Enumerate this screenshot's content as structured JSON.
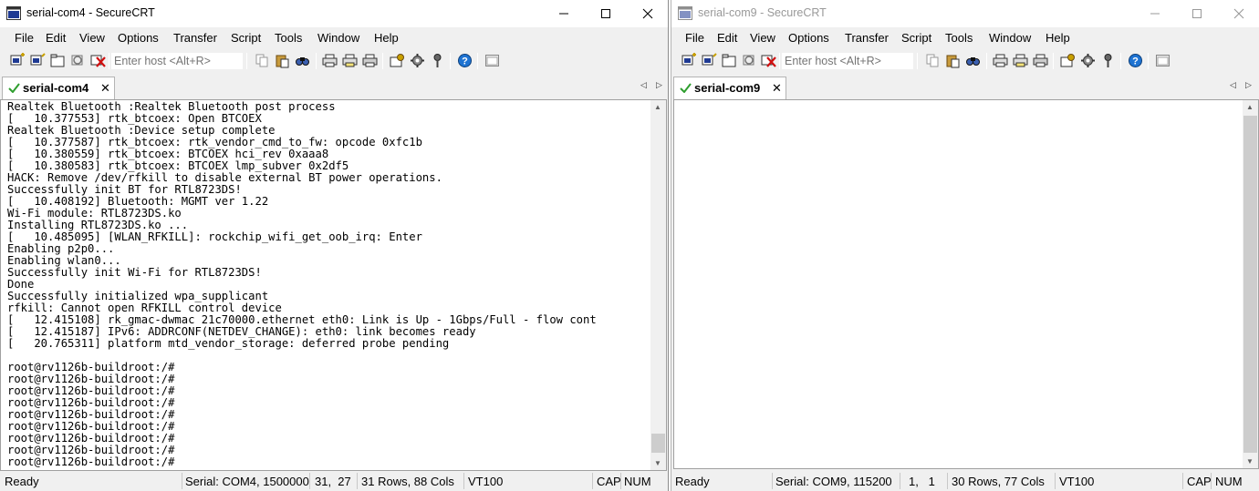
{
  "menu_labels": [
    "File",
    "Edit",
    "View",
    "Options",
    "Transfer",
    "Script",
    "Tools",
    "Window",
    "Help"
  ],
  "host_placeholder": "Enter host <Alt+R>",
  "left": {
    "title": "serial-com4 - SecureCRT",
    "tab_label": "serial-com4",
    "terminal_lines": [
      "Realtek Bluetooth :Realtek Bluetooth post process",
      "[   10.377553] rtk_btcoex: Open BTCOEX",
      "Realtek Bluetooth :Device setup complete",
      "[   10.377587] rtk_btcoex: rtk_vendor_cmd_to_fw: opcode 0xfc1b",
      "[   10.380559] rtk_btcoex: BTCOEX hci_rev 0xaaa8",
      "[   10.380583] rtk_btcoex: BTCOEX lmp_subver 0x2df5",
      "HACK: Remove /dev/rfkill to disable external BT power operations.",
      "Successfully init BT for RTL8723DS!",
      "[   10.408192] Bluetooth: MGMT ver 1.22",
      "Wi-Fi module: RTL8723DS.ko",
      "Installing RTL8723DS.ko ...",
      "[   10.485095] [WLAN_RFKILL]: rockchip_wifi_get_oob_irq: Enter",
      "Enabling p2p0...",
      "Enabling wlan0...",
      "Successfully init Wi-Fi for RTL8723DS!",
      "Done",
      "Successfully initialized wpa_supplicant",
      "rfkill: Cannot open RFKILL control device",
      "[   12.415108] rk_gmac-dwmac 21c70000.ethernet eth0: Link is Up - 1Gbps/Full - flow cont",
      "[   12.415187] IPv6: ADDRCONF(NETDEV_CHANGE): eth0: link becomes ready",
      "[   20.765311] platform mtd_vendor_storage: deferred probe pending",
      "",
      "root@rv1126b-buildroot:/#",
      "root@rv1126b-buildroot:/#",
      "root@rv1126b-buildroot:/#",
      "root@rv1126b-buildroot:/#",
      "root@rv1126b-buildroot:/#",
      "root@rv1126b-buildroot:/#",
      "root@rv1126b-buildroot:/#",
      "root@rv1126b-buildroot:/#",
      "root@rv1126b-buildroot:/#"
    ],
    "status": {
      "ready": "Ready",
      "serial": "Serial: COM4, 1500000",
      "cursor": "31,  27",
      "size": "31 Rows, 88 Cols",
      "emulation": "VT100",
      "cap": "CAP",
      "num": "NUM"
    }
  },
  "right": {
    "title": "serial-com9 - SecureCRT",
    "tab_label": "serial-com9",
    "status": {
      "ready": "Ready",
      "serial": "Serial: COM9, 115200",
      "cursor": "1,   1",
      "size": "30 Rows, 77 Cols",
      "emulation": "VT100",
      "cap": "CAP",
      "num": "NUM"
    }
  },
  "colors": {
    "chrome": "#f0f0f0",
    "terminal_bg": "#ffffff",
    "tab_check": "#2e9e2e",
    "help_icon": "#1e73d2"
  },
  "icons": {
    "app": "securecrt-app-icon",
    "minimize": "minimize-icon",
    "maximize": "maximize-icon",
    "close": "close-icon",
    "tab_status": "connected-check-icon"
  }
}
